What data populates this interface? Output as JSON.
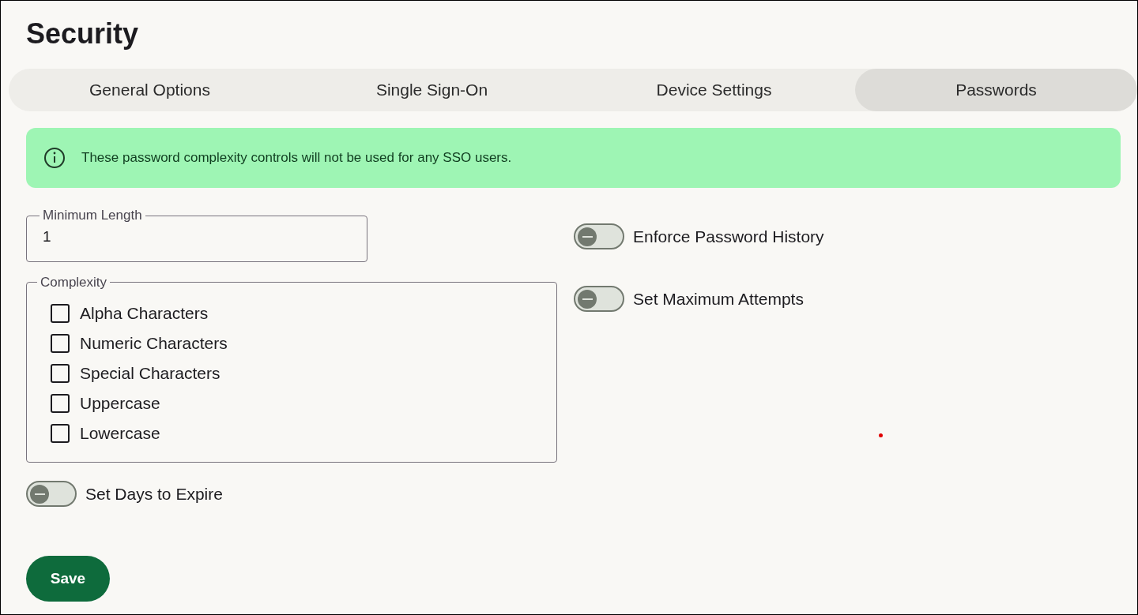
{
  "title": "Security",
  "tabs": [
    {
      "label": "General Options",
      "selected": false
    },
    {
      "label": "Single Sign-On",
      "selected": false
    },
    {
      "label": "Device Settings",
      "selected": false
    },
    {
      "label": "Passwords",
      "selected": true
    }
  ],
  "alert": {
    "text": "These password complexity controls will not be used for any SSO users."
  },
  "minimum_length": {
    "label": "Minimum Length",
    "value": "1"
  },
  "complexity": {
    "legend": "Complexity",
    "options": [
      {
        "label": "Alpha Characters",
        "checked": false
      },
      {
        "label": "Numeric Characters",
        "checked": false
      },
      {
        "label": "Special Characters",
        "checked": false
      },
      {
        "label": "Uppercase",
        "checked": false
      },
      {
        "label": "Lowercase",
        "checked": false
      }
    ]
  },
  "days_to_expire": {
    "label": "Set Days to Expire",
    "on": false
  },
  "right_toggles": [
    {
      "label": "Enforce Password History",
      "on": false
    },
    {
      "label": "Set Maximum Attempts",
      "on": false
    }
  ],
  "save_button": "Save"
}
